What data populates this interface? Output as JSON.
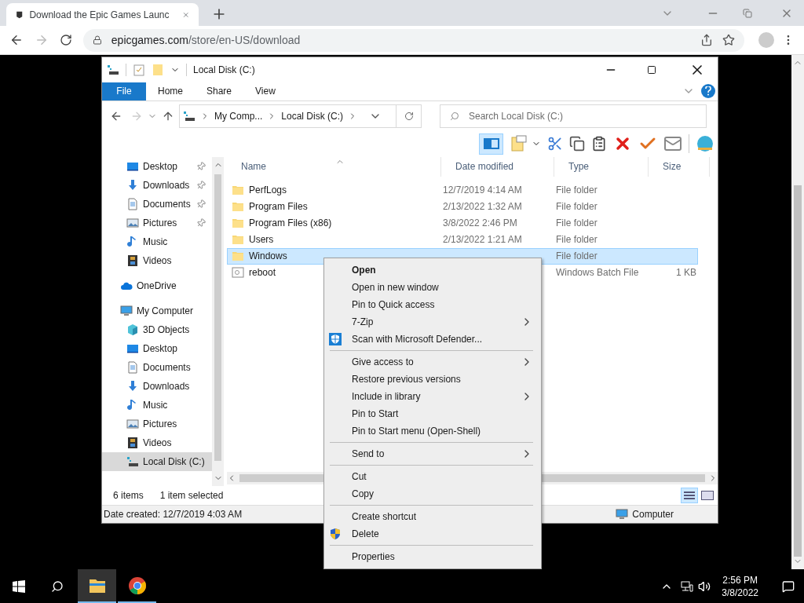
{
  "browser": {
    "tab_title": "Download the Epic Games Launc",
    "address_domain": "epicgames.com",
    "address_path": "/store/en-US/download"
  },
  "explorer": {
    "title": "Local Disk (C:)",
    "file_tab": "File",
    "ribbon_tabs": [
      "Home",
      "Share",
      "View"
    ],
    "breadcrumbs": [
      "My Comp...",
      "Local Disk (C:)"
    ],
    "search_placeholder": "Search Local Disk (C:)",
    "sidebar": [
      {
        "children": [
          {
            "label": "Desktop",
            "kind": "desktop",
            "pinned": true,
            "selected": false
          },
          {
            "label": "Downloads",
            "kind": "downloads",
            "pinned": true,
            "selected": false
          },
          {
            "label": "Documents",
            "kind": "documents",
            "pinned": true,
            "selected": false
          },
          {
            "label": "Pictures",
            "kind": "pictures",
            "pinned": true,
            "selected": false
          },
          {
            "label": "Music",
            "kind": "music",
            "pinned": false,
            "selected": false
          },
          {
            "label": "Videos",
            "kind": "videos",
            "pinned": false,
            "selected": false
          }
        ]
      },
      {
        "label": "OneDrive",
        "kind": "onedrive",
        "pinned": false,
        "selected": false
      },
      {
        "label": "My Computer",
        "kind": "computer",
        "pinned": false,
        "selected": false,
        "children": [
          {
            "label": "3D Objects",
            "kind": "objects3d",
            "pinned": false,
            "selected": false
          },
          {
            "label": "Desktop",
            "kind": "desktop",
            "pinned": false,
            "selected": false
          },
          {
            "label": "Documents",
            "kind": "documents",
            "pinned": false,
            "selected": false
          },
          {
            "label": "Downloads",
            "kind": "downloads",
            "pinned": false,
            "selected": false
          },
          {
            "label": "Music",
            "kind": "music",
            "pinned": false,
            "selected": false
          },
          {
            "label": "Pictures",
            "kind": "pictures",
            "pinned": false,
            "selected": false
          },
          {
            "label": "Videos",
            "kind": "videos",
            "pinned": false,
            "selected": false
          },
          {
            "label": "Local Disk (C:)",
            "kind": "disk",
            "pinned": false,
            "selected": true
          }
        ]
      }
    ],
    "columns": [
      "Name",
      "Date modified",
      "Type",
      "Size"
    ],
    "files": [
      {
        "name": "PerfLogs",
        "date": "12/7/2019 4:14 AM",
        "type": "File folder",
        "kind": "folder",
        "selected": false
      },
      {
        "name": "Program Files",
        "date": "2/13/2022 1:32 AM",
        "type": "File folder",
        "kind": "folder",
        "selected": false
      },
      {
        "name": "Program Files (x86)",
        "date": "3/8/2022 2:46 PM",
        "type": "File folder",
        "kind": "folder",
        "selected": false
      },
      {
        "name": "Users",
        "date": "2/13/2022 1:21 AM",
        "type": "File folder",
        "kind": "folder",
        "selected": false
      },
      {
        "name": "Windows",
        "type": "File folder",
        "kind": "folder",
        "selected": true
      },
      {
        "name": "reboot",
        "type": "Windows Batch File",
        "size": "1 KB",
        "kind": "batch",
        "selected": false
      }
    ],
    "item_count": "6 items",
    "selection_count": "1 item selected",
    "details": "Date created: 12/7/2019 4:03 AM",
    "location": "Computer"
  },
  "context_menu": [
    {
      "kind": "item",
      "label": "Open",
      "default": true,
      "submenu": false
    },
    {
      "kind": "item",
      "label": "Open in new window",
      "default": false,
      "submenu": false
    },
    {
      "kind": "item",
      "label": "Pin to Quick access",
      "default": false,
      "submenu": false
    },
    {
      "kind": "item",
      "label": "7-Zip",
      "default": false,
      "submenu": true
    },
    {
      "kind": "scan",
      "label": "Scan with Microsoft Defender...",
      "default": false,
      "submenu": false
    },
    {
      "kind": "separator"
    },
    {
      "kind": "item",
      "label": "Give access to",
      "default": false,
      "submenu": true
    },
    {
      "kind": "item",
      "label": "Restore previous versions",
      "default": false,
      "submenu": false
    },
    {
      "kind": "item",
      "label": "Include in library",
      "default": false,
      "submenu": true
    },
    {
      "kind": "item",
      "label": "Pin to Start",
      "default": false,
      "submenu": false
    },
    {
      "kind": "item",
      "label": "Pin to Start menu (Open-Shell)",
      "default": false,
      "submenu": false
    },
    {
      "kind": "separator"
    },
    {
      "kind": "item",
      "label": "Send to",
      "default": false,
      "submenu": true
    },
    {
      "kind": "separator"
    },
    {
      "kind": "item",
      "label": "Cut",
      "default": false,
      "submenu": false
    },
    {
      "kind": "item",
      "label": "Copy",
      "default": false,
      "submenu": false
    },
    {
      "kind": "separator"
    },
    {
      "kind": "item",
      "label": "Create shortcut",
      "default": false,
      "submenu": false
    },
    {
      "kind": "admin",
      "label": "Delete",
      "default": false,
      "submenu": false
    },
    {
      "kind": "separator"
    },
    {
      "kind": "item",
      "label": "Properties",
      "default": false,
      "submenu": false
    }
  ],
  "taskbar": {
    "apps": [
      {
        "kind": "explorer",
        "selected": true
      },
      {
        "kind": "chrome",
        "selected": false
      }
    ],
    "time": "2:56 PM",
    "date": "3/8/2022"
  }
}
